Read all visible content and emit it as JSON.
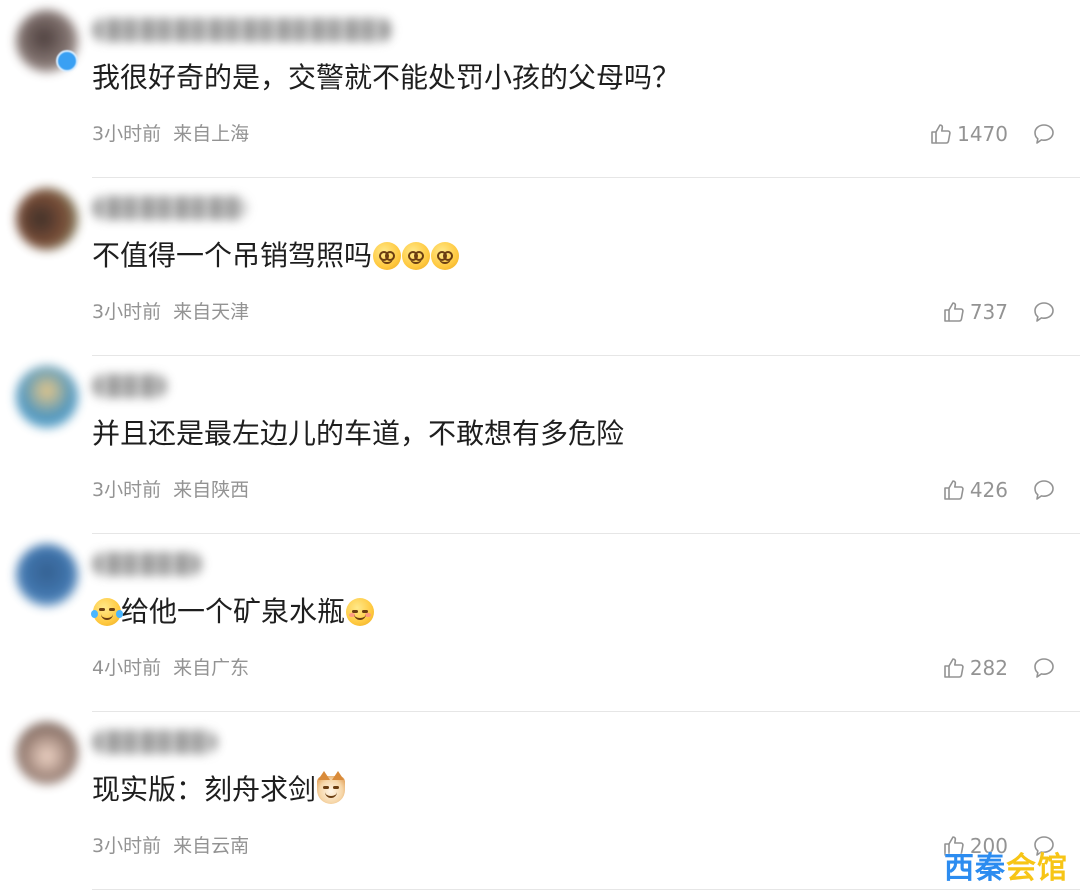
{
  "comments": [
    {
      "text": "我很好奇的是，交警就不能处罚小孩的父母吗？",
      "time": "3小时前",
      "location": "来自上海",
      "likes": "1470",
      "avatar_color": "#6b5a55",
      "verified": true,
      "emojis": []
    },
    {
      "text": "不值得一个吊销驾照吗",
      "time": "3小时前",
      "location": "来自天津",
      "likes": "737",
      "avatar_color": "#5a3a2a",
      "verified": false,
      "emojis": [
        "dizzy-face-emoji",
        "dizzy-face-emoji",
        "dizzy-face-emoji"
      ]
    },
    {
      "text": "并且还是最左边儿的车道，不敢想有多危险",
      "time": "3小时前",
      "location": "来自陕西",
      "likes": "426",
      "avatar_color": "#3d8bb8",
      "verified": false,
      "emojis": []
    },
    {
      "text": "给他一个矿泉水瓶",
      "time": "4小时前",
      "location": "来自广东",
      "likes": "282",
      "avatar_color": "#2f6aa8",
      "verified": false,
      "leading_emoji": "laugh-tears-emoji",
      "emojis": [
        "shy-face-emoji"
      ]
    },
    {
      "text": "现实版：刻舟求剑",
      "time": "3小时前",
      "location": "来自云南",
      "likes": "200",
      "avatar_color": "#8a6e62",
      "verified": false,
      "emojis": [
        "cat-face-emoji"
      ]
    }
  ],
  "watermark": {
    "part1": "西秦",
    "part2": "会馆"
  },
  "colors": {
    "meta_gray": "#939393",
    "divider": "#e6e6e6",
    "watermark_blue": "#2c8cf0",
    "watermark_yellow": "#f7c516"
  },
  "icons": {
    "like": "thumbs-up-icon",
    "reply": "comment-bubble-icon"
  }
}
